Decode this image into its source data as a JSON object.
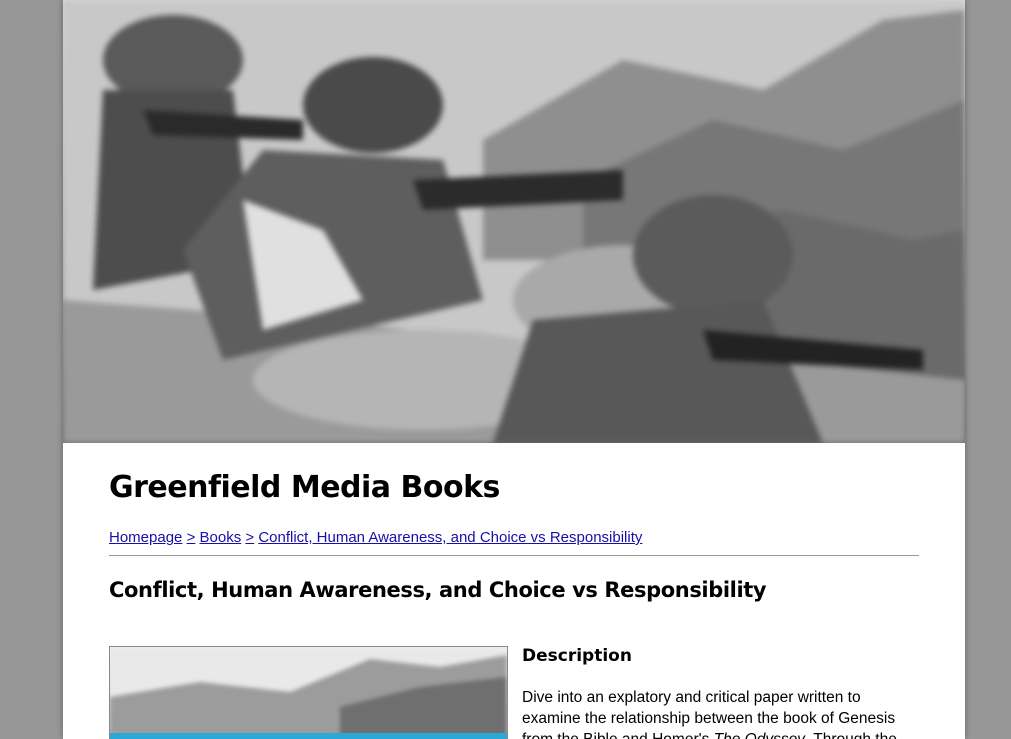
{
  "header": {
    "site_title": "Greenfield Media Books"
  },
  "breadcrumb": {
    "items": [
      "Homepage",
      "Books",
      "Conflict, Human Awareness, and Choice vs Responsibility"
    ],
    "separator": ">"
  },
  "book": {
    "title": "Conflict, Human Awareness, and Choice vs Responsibility"
  },
  "description": {
    "heading": "Description",
    "text_part1": "Dive into an explatory and critical paper written to examine the relationship between the book of Genesis from the Bible and Homer's ",
    "italic_title": "The Odyssey",
    "text_part2": ". Through the"
  },
  "colors": {
    "page_background": "#979797",
    "link": "#1a0dab",
    "cover_band": "#2aa8d8"
  }
}
